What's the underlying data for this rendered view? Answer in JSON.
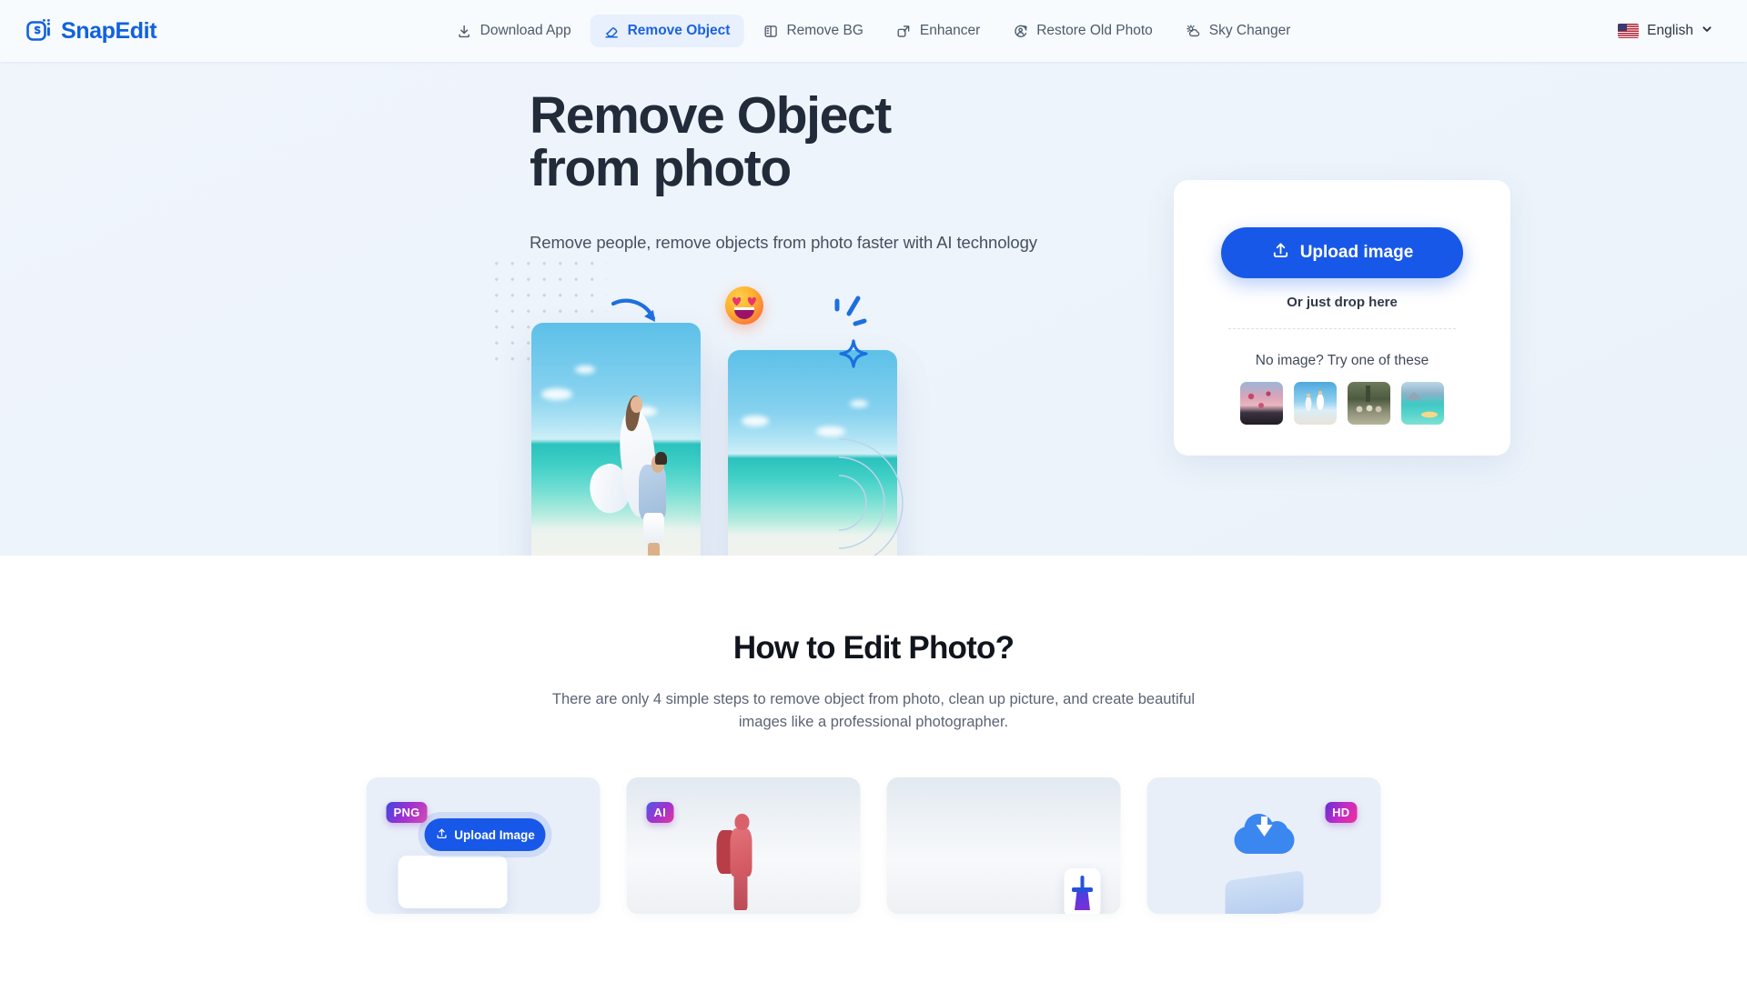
{
  "nav": {
    "brand": "SnapEdit",
    "items": [
      {
        "label": "Download App",
        "icon": "download-icon",
        "active": false
      },
      {
        "label": "Remove Object",
        "icon": "eraser-icon",
        "active": true
      },
      {
        "label": "Remove BG",
        "icon": "remove-bg-icon",
        "active": false
      },
      {
        "label": "Enhancer",
        "icon": "enhancer-icon",
        "active": false
      },
      {
        "label": "Restore Old Photo",
        "icon": "restore-photo-icon",
        "active": false
      },
      {
        "label": "Sky Changer",
        "icon": "sky-changer-icon",
        "active": false
      }
    ],
    "language": "English",
    "language_flag": "us-flag-icon"
  },
  "hero": {
    "title_line1": "Remove Object",
    "title_line2": "from photo",
    "subtitle": "Remove people, remove objects from photo faster with AI technology",
    "highlight_color": "#2ff6ef"
  },
  "upload": {
    "button_label": "Upload image",
    "button_icon": "upload-icon",
    "drop_label": "Or just drop here",
    "sample_label": "No image? Try one of these",
    "samples": [
      {
        "name": "hot-air-balloons-sunset"
      },
      {
        "name": "couple-jumping-beach"
      },
      {
        "name": "group-of-people-forest"
      },
      {
        "name": "island-turquoise-sea"
      }
    ],
    "accent_color": "#1858e8"
  },
  "howto": {
    "title": "How to Edit Photo?",
    "subtitle": "There are only 4 simple steps to remove object from photo, clean up picture, and create beautiful images like a professional photographer.",
    "steps": [
      {
        "badge": "PNG",
        "action_label": "Upload Image",
        "action_icon": "upload-icon"
      },
      {
        "badge": "AI",
        "action_label": "",
        "action_icon": ""
      },
      {
        "badge": "",
        "action_label": "",
        "action_icon": "broom-icon"
      },
      {
        "badge": "HD",
        "action_label": "",
        "action_icon": "cloud-download-icon"
      }
    ]
  }
}
